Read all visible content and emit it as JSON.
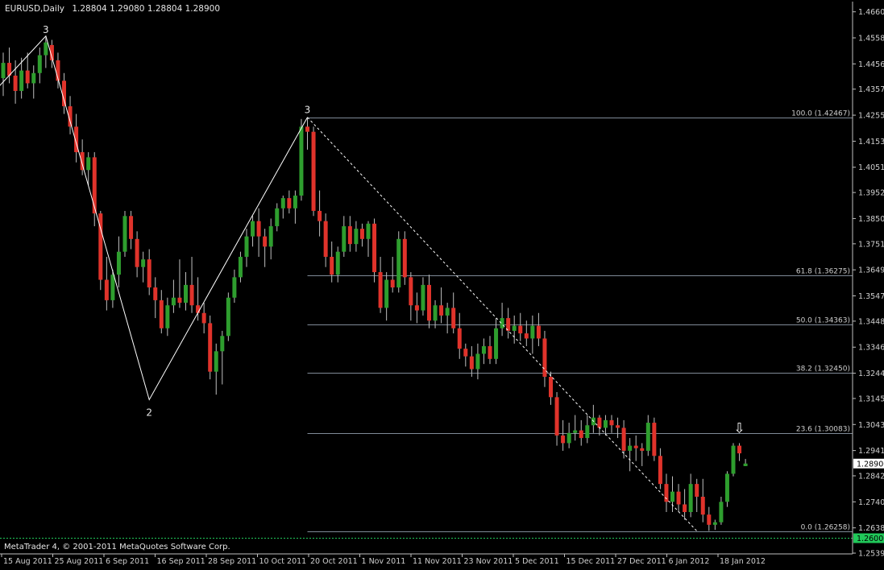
{
  "header": {
    "symbol": "EURUSD,Daily",
    "ohlc": "1.28804 1.29080 1.28804 1.28900"
  },
  "footer": {
    "copyright": "MetaTrader 4, © 2001-2011 MetaQuotes Software Corp."
  },
  "colors": {
    "background": "#000000",
    "bull": "#2e9e2e",
    "bear": "#e0332b",
    "wick": "#bfbfbf",
    "line": "#ffffff",
    "grid": "#7f8a97",
    "text": "#cfcfcf",
    "support": "#21c95a",
    "current_price_bg": "#ffffff",
    "support_price_bg": "#21c95a"
  },
  "chart_data": {
    "type": "candlestick",
    "title": "EURUSD,Daily",
    "ylim": [
      1.2536,
      1.47
    ],
    "y_ticks": [
      "1.46600",
      "1.45580",
      "1.44560",
      "1.43570",
      "1.42550",
      "1.41530",
      "1.40510",
      "1.39520",
      "1.38500",
      "1.37510",
      "1.36490",
      "1.35470",
      "1.34480",
      "1.33460",
      "1.32440",
      "1.31450",
      "1.30430",
      "1.29410",
      "1.28420",
      "1.27400",
      "1.26380",
      "1.25390"
    ],
    "x_ticks": [
      "15 Aug 2011",
      "25 Aug 2011",
      "6 Sep 2011",
      "16 Sep 2011",
      "28 Sep 2011",
      "10 Oct 2011",
      "20 Oct 2011",
      "1 Nov 2011",
      "11 Nov 2011",
      "23 Nov 2011",
      "5 Dec 2011",
      "15 Dec 2011",
      "27 Dec 2011",
      "6 Jan 2012",
      "18 Jan 2012"
    ],
    "candles": [
      [
        1.44,
        1.45,
        1.433,
        1.446
      ],
      [
        1.446,
        1.452,
        1.438,
        1.441
      ],
      [
        1.441,
        1.447,
        1.43,
        1.435
      ],
      [
        1.435,
        1.448,
        1.432,
        1.443
      ],
      [
        1.443,
        1.45,
        1.436,
        1.438
      ],
      [
        1.438,
        1.445,
        1.432,
        1.442
      ],
      [
        1.442,
        1.452,
        1.438,
        1.449
      ],
      [
        1.449,
        1.456,
        1.444,
        1.454
      ],
      [
        1.453,
        1.455,
        1.444,
        1.447
      ],
      [
        1.447,
        1.45,
        1.436,
        1.439
      ],
      [
        1.439,
        1.442,
        1.426,
        1.429
      ],
      [
        1.429,
        1.433,
        1.418,
        1.421
      ],
      [
        1.421,
        1.426,
        1.407,
        1.411
      ],
      [
        1.411,
        1.416,
        1.402,
        1.404
      ],
      [
        1.404,
        1.411,
        1.398,
        1.409
      ],
      [
        1.409,
        1.411,
        1.382,
        1.387
      ],
      [
        1.387,
        1.388,
        1.357,
        1.361
      ],
      [
        1.361,
        1.37,
        1.349,
        1.353
      ],
      [
        1.353,
        1.365,
        1.35,
        1.363
      ],
      [
        1.363,
        1.378,
        1.358,
        1.372
      ],
      [
        1.372,
        1.388,
        1.37,
        1.386
      ],
      [
        1.386,
        1.388,
        1.373,
        1.377
      ],
      [
        1.377,
        1.38,
        1.362,
        1.366
      ],
      [
        1.366,
        1.372,
        1.36,
        1.369
      ],
      [
        1.369,
        1.373,
        1.355,
        1.358
      ],
      [
        1.358,
        1.362,
        1.346,
        1.353
      ],
      [
        1.353,
        1.357,
        1.34,
        1.342
      ],
      [
        1.342,
        1.354,
        1.339,
        1.351
      ],
      [
        1.351,
        1.361,
        1.348,
        1.354
      ],
      [
        1.354,
        1.369,
        1.35,
        1.352
      ],
      [
        1.352,
        1.364,
        1.349,
        1.359
      ],
      [
        1.359,
        1.37,
        1.348,
        1.351
      ],
      [
        1.351,
        1.362,
        1.345,
        1.348
      ],
      [
        1.348,
        1.352,
        1.34,
        1.344
      ],
      [
        1.344,
        1.347,
        1.322,
        1.325
      ],
      [
        1.325,
        1.336,
        1.316,
        1.333
      ],
      [
        1.333,
        1.341,
        1.32,
        1.339
      ],
      [
        1.339,
        1.356,
        1.337,
        1.354
      ],
      [
        1.354,
        1.365,
        1.352,
        1.362
      ],
      [
        1.362,
        1.372,
        1.36,
        1.37
      ],
      [
        1.37,
        1.381,
        1.366,
        1.378
      ],
      [
        1.378,
        1.386,
        1.374,
        1.384
      ],
      [
        1.384,
        1.389,
        1.37,
        1.378
      ],
      [
        1.378,
        1.381,
        1.366,
        1.374
      ],
      [
        1.374,
        1.385,
        1.369,
        1.382
      ],
      [
        1.382,
        1.391,
        1.38,
        1.389
      ],
      [
        1.389,
        1.394,
        1.385,
        1.393
      ],
      [
        1.393,
        1.396,
        1.387,
        1.389
      ],
      [
        1.389,
        1.396,
        1.383,
        1.394
      ],
      [
        1.394,
        1.424,
        1.392,
        1.421
      ],
      [
        1.421,
        1.4247,
        1.412,
        1.419
      ],
      [
        1.419,
        1.421,
        1.386,
        1.388
      ],
      [
        1.388,
        1.396,
        1.378,
        1.384
      ],
      [
        1.384,
        1.387,
        1.366,
        1.37
      ],
      [
        1.37,
        1.376,
        1.36,
        1.363
      ],
      [
        1.363,
        1.374,
        1.36,
        1.372
      ],
      [
        1.372,
        1.386,
        1.37,
        1.382
      ],
      [
        1.382,
        1.386,
        1.372,
        1.375
      ],
      [
        1.375,
        1.384,
        1.372,
        1.381
      ],
      [
        1.381,
        1.383,
        1.374,
        1.377
      ],
      [
        1.377,
        1.384,
        1.37,
        1.383
      ],
      [
        1.383,
        1.385,
        1.36,
        1.364
      ],
      [
        1.364,
        1.37,
        1.348,
        1.35
      ],
      [
        1.35,
        1.364,
        1.345,
        1.361
      ],
      [
        1.361,
        1.37,
        1.356,
        1.358
      ],
      [
        1.358,
        1.38,
        1.356,
        1.377
      ],
      [
        1.377,
        1.38,
        1.359,
        1.362
      ],
      [
        1.362,
        1.364,
        1.345,
        1.351
      ],
      [
        1.351,
        1.356,
        1.344,
        1.349
      ],
      [
        1.349,
        1.362,
        1.347,
        1.359
      ],
      [
        1.359,
        1.363,
        1.342,
        1.345
      ],
      [
        1.345,
        1.353,
        1.342,
        1.351
      ],
      [
        1.351,
        1.358,
        1.344,
        1.347
      ],
      [
        1.347,
        1.352,
        1.34,
        1.35
      ],
      [
        1.35,
        1.356,
        1.34,
        1.342
      ],
      [
        1.342,
        1.348,
        1.33,
        1.334
      ],
      [
        1.334,
        1.336,
        1.327,
        1.331
      ],
      [
        1.331,
        1.335,
        1.323,
        1.326
      ],
      [
        1.326,
        1.336,
        1.322,
        1.332
      ],
      [
        1.332,
        1.338,
        1.328,
        1.335
      ],
      [
        1.335,
        1.339,
        1.328,
        1.33
      ],
      [
        1.33,
        1.346,
        1.328,
        1.342
      ],
      [
        1.342,
        1.352,
        1.339,
        1.346
      ],
      [
        1.346,
        1.35,
        1.338,
        1.341
      ],
      [
        1.341,
        1.347,
        1.336,
        1.343
      ],
      [
        1.343,
        1.348,
        1.337,
        1.34
      ],
      [
        1.34,
        1.345,
        1.335,
        1.338
      ],
      [
        1.338,
        1.347,
        1.332,
        1.343
      ],
      [
        1.343,
        1.348,
        1.335,
        1.338
      ],
      [
        1.338,
        1.341,
        1.319,
        1.323
      ],
      [
        1.323,
        1.325,
        1.312,
        1.315
      ],
      [
        1.315,
        1.317,
        1.296,
        1.3
      ],
      [
        1.3,
        1.306,
        1.294,
        1.297
      ],
      [
        1.297,
        1.305,
        1.295,
        1.301
      ],
      [
        1.301,
        1.308,
        1.298,
        1.302
      ],
      [
        1.302,
        1.306,
        1.296,
        1.299
      ],
      [
        1.299,
        1.308,
        1.297,
        1.304
      ],
      [
        1.304,
        1.312,
        1.301,
        1.307
      ],
      [
        1.307,
        1.308,
        1.3,
        1.303
      ],
      [
        1.303,
        1.308,
        1.3,
        1.306
      ],
      [
        1.306,
        1.308,
        1.301,
        1.304
      ],
      [
        1.304,
        1.307,
        1.299,
        1.303
      ],
      [
        1.303,
        1.306,
        1.291,
        1.294
      ],
      [
        1.294,
        1.299,
        1.286,
        1.296
      ],
      [
        1.296,
        1.3,
        1.29,
        1.295
      ],
      [
        1.295,
        1.297,
        1.288,
        1.294
      ],
      [
        1.294,
        1.308,
        1.292,
        1.305
      ],
      [
        1.305,
        1.307,
        1.29,
        1.292
      ],
      [
        1.292,
        1.295,
        1.279,
        1.281
      ],
      [
        1.281,
        1.285,
        1.27,
        1.274
      ],
      [
        1.274,
        1.284,
        1.27,
        1.278
      ],
      [
        1.278,
        1.281,
        1.27,
        1.273
      ],
      [
        1.273,
        1.279,
        1.267,
        1.27
      ],
      [
        1.27,
        1.285,
        1.268,
        1.281
      ],
      [
        1.281,
        1.283,
        1.27,
        1.276
      ],
      [
        1.276,
        1.283,
        1.266,
        1.269
      ],
      [
        1.269,
        1.272,
        1.2626,
        1.265
      ],
      [
        1.265,
        1.267,
        1.263,
        1.266
      ],
      [
        1.266,
        1.276,
        1.265,
        1.274
      ],
      [
        1.274,
        1.286,
        1.272,
        1.285
      ],
      [
        1.285,
        1.297,
        1.284,
        1.296
      ],
      [
        1.296,
        1.297,
        1.29,
        1.293
      ],
      [
        1.288,
        1.2908,
        1.288,
        1.289
      ]
    ],
    "fib_levels": [
      {
        "label": "100.0 (1.42467)",
        "value": 1.42467
      },
      {
        "label": "61.8 (1.36275)",
        "value": 1.36275
      },
      {
        "label": "50.0 (1.34363)",
        "value": 1.34363
      },
      {
        "label": "38.2 (1.32450)",
        "value": 1.3245
      },
      {
        "label": "23.6 (1.30083)",
        "value": 1.30083
      },
      {
        "label": "0.0 (1.26258)",
        "value": 1.26258
      }
    ],
    "fib_trendline": {
      "from": {
        "bar": 50,
        "price": 1.42467
      },
      "to": {
        "bar": 114,
        "price": 1.26258
      }
    },
    "wave_line": [
      {
        "bar": -1,
        "price": 1.436
      },
      {
        "bar": 7,
        "price": 1.4565
      },
      {
        "bar": 24,
        "price": 1.314
      },
      {
        "bar": 50,
        "price": 1.42467
      }
    ],
    "wave_labels": [
      {
        "text": "3",
        "bar": 7,
        "price": 1.459
      },
      {
        "text": "2",
        "bar": 24,
        "price": 1.309
      },
      {
        "text": "3",
        "bar": 50,
        "price": 1.4275
      }
    ],
    "current_price": {
      "label": "1.28900",
      "value": 1.289
    },
    "support": {
      "label": "1.26000",
      "value": 1.26
    },
    "signal_arrow": {
      "glyph": "⇩",
      "bar": 121,
      "price": 1.301
    }
  }
}
